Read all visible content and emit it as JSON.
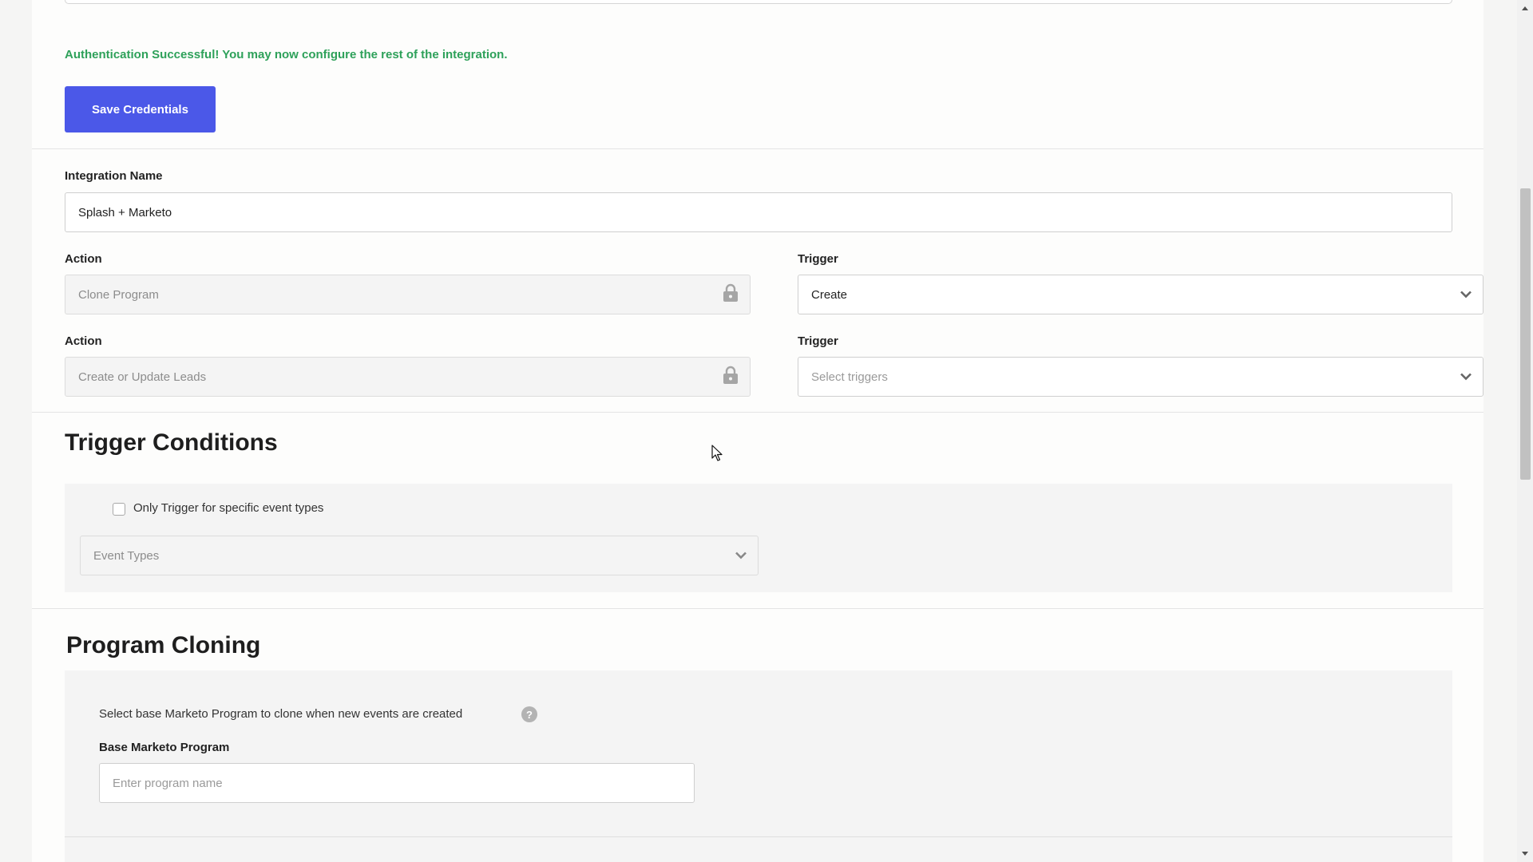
{
  "auth": {
    "success_message": "Authentication Successful! You may now configure the rest of the integration.",
    "save_button": "Save Credentials"
  },
  "integration": {
    "name_label": "Integration Name",
    "name_value": "Splash + Marketo"
  },
  "rows": [
    {
      "action_label": "Action",
      "action_value": "Clone Program",
      "trigger_label": "Trigger",
      "trigger_value": "Create"
    },
    {
      "action_label": "Action",
      "action_value": "Create or Update Leads",
      "trigger_label": "Trigger",
      "trigger_placeholder": "Select triggers"
    }
  ],
  "trigger_conditions": {
    "title": "Trigger Conditions",
    "checkbox_label": "Only Trigger for specific event types",
    "checkbox_checked": false,
    "event_types_placeholder": "Event Types"
  },
  "program_cloning": {
    "title": "Program Cloning",
    "description": "Select base Marketo Program to clone when new events are created",
    "base_label": "Base Marketo Program",
    "base_placeholder": "Enter program name"
  },
  "colors": {
    "accent": "#4b58e8",
    "success": "#2ea15a"
  },
  "icons": {
    "lock": "lock-icon",
    "dropdown": "chevron-down-icon",
    "help": "help-icon",
    "help_glyph": "?"
  }
}
